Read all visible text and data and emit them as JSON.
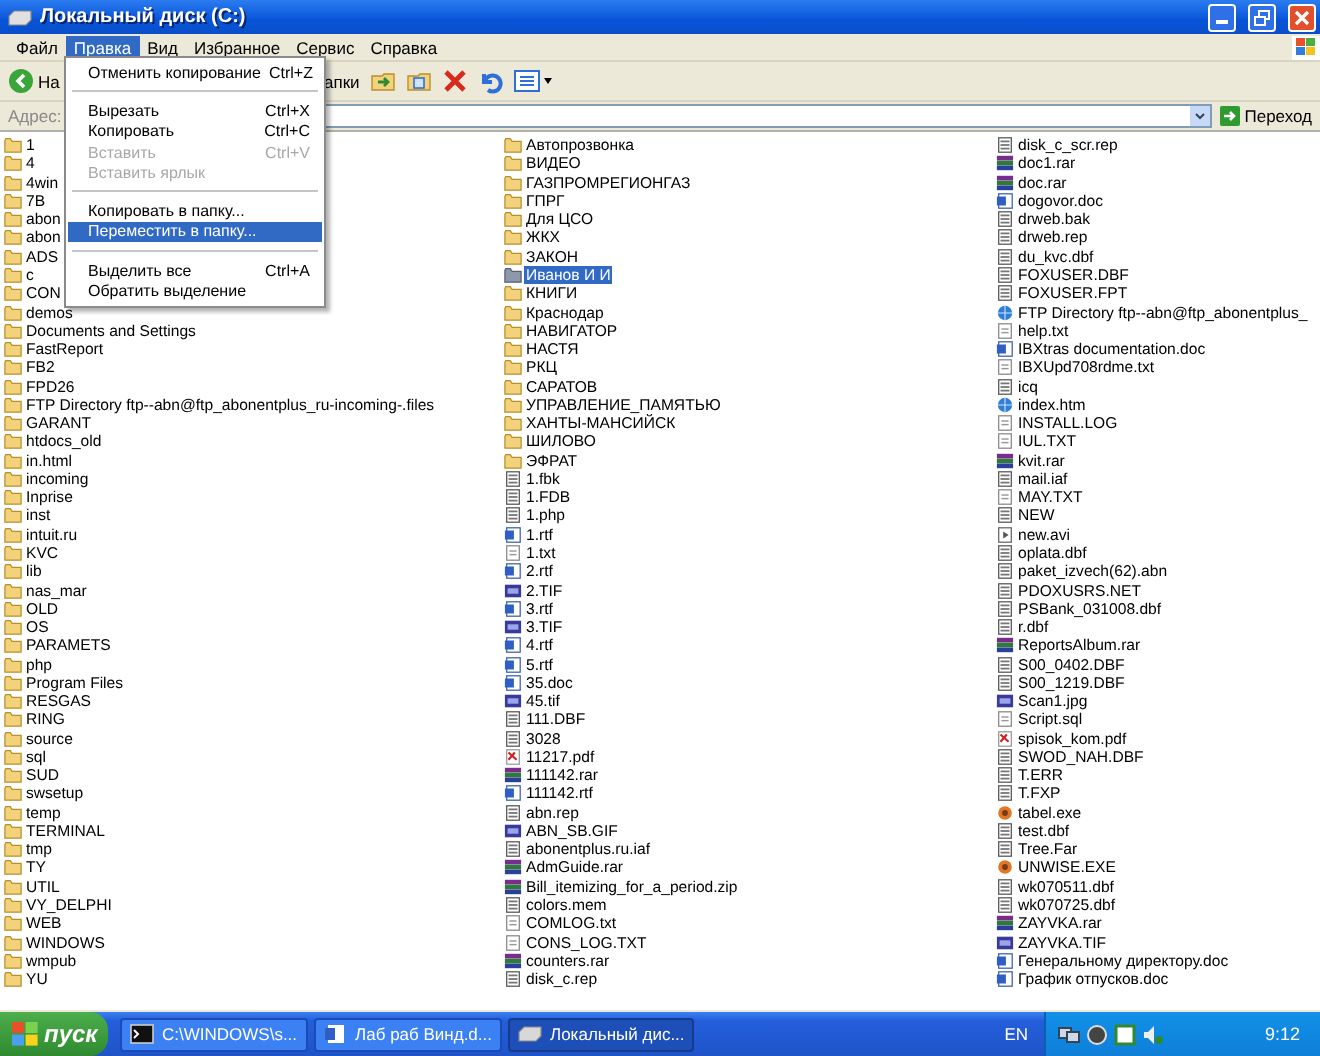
{
  "window": {
    "title": "Локальный диск (C:)"
  },
  "menu_bar": [
    {
      "label": "Файл",
      "selected": false
    },
    {
      "label": "Правка",
      "selected": true
    },
    {
      "label": "Вид",
      "selected": false
    },
    {
      "label": "Избранное",
      "selected": false
    },
    {
      "label": "Сервис",
      "selected": false
    },
    {
      "label": "Справка",
      "selected": false
    }
  ],
  "edit_menu": [
    {
      "kind": "command",
      "label": "Отменить копирование",
      "shortcut": "Ctrl+Z",
      "disabled": false,
      "selected": false
    },
    {
      "kind": "separator"
    },
    {
      "kind": "command",
      "label": "Вырезать",
      "shortcut": "Ctrl+X",
      "disabled": false,
      "selected": false
    },
    {
      "kind": "command",
      "label": "Копировать",
      "shortcut": "Ctrl+C",
      "disabled": false,
      "selected": false
    },
    {
      "kind": "command",
      "label": "Вставить",
      "shortcut": "Ctrl+V",
      "disabled": true,
      "selected": false
    },
    {
      "kind": "command",
      "label": "Вставить ярлык",
      "disabled": true,
      "selected": false
    },
    {
      "kind": "separator"
    },
    {
      "kind": "command",
      "label": "Копировать в папку...",
      "disabled": false,
      "selected": false
    },
    {
      "kind": "command",
      "label": "Переместить в папку...",
      "disabled": false,
      "selected": true
    },
    {
      "kind": "separator"
    },
    {
      "kind": "command",
      "label": "Выделить все",
      "shortcut": "Ctrl+A",
      "disabled": false,
      "selected": false
    },
    {
      "kind": "command",
      "label": "Обратить выделение",
      "disabled": false,
      "selected": false
    }
  ],
  "toolbar": {
    "back_button": "На",
    "folders_button": "апки"
  },
  "address_bar": {
    "label": "Адрес:",
    "go_button": "Переход"
  },
  "file_list": {
    "columns": [
      [
        {
          "name": "1",
          "kind": "folder",
          "selected": false
        },
        {
          "name": "4",
          "kind": "folder",
          "selected": false
        },
        {
          "name": "4win",
          "kind": "folder",
          "selected": false
        },
        {
          "name": "7B",
          "kind": "folder",
          "selected": false
        },
        {
          "name": "abon",
          "kind": "folder",
          "selected": false
        },
        {
          "name": "abon",
          "kind": "folder",
          "selected": false
        },
        {
          "name": "ADS",
          "kind": "folder",
          "selected": false
        },
        {
          "name": "c",
          "kind": "folder",
          "selected": false
        },
        {
          "name": "CON",
          "kind": "folder",
          "selected": false
        },
        {
          "name": "demos",
          "kind": "folder",
          "selected": false
        },
        {
          "name": "Documents and Settings",
          "kind": "folder",
          "selected": false
        },
        {
          "name": "FastReport",
          "kind": "folder",
          "selected": false
        },
        {
          "name": "FB2",
          "kind": "folder",
          "selected": false
        },
        {
          "name": "FPD26",
          "kind": "folder",
          "selected": false
        },
        {
          "name": "FTP Directory ftp--abn@ftp_abonentplus_ru-incoming-.files",
          "kind": "folder",
          "selected": false
        },
        {
          "name": "GARANT",
          "kind": "folder",
          "selected": false
        },
        {
          "name": "htdocs_old",
          "kind": "folder",
          "selected": false
        },
        {
          "name": "in.html",
          "kind": "folder",
          "selected": false
        },
        {
          "name": "incoming",
          "kind": "folder",
          "selected": false
        },
        {
          "name": "Inprise",
          "kind": "folder",
          "selected": false
        },
        {
          "name": "inst",
          "kind": "folder",
          "selected": false
        },
        {
          "name": "intuit.ru",
          "kind": "folder",
          "selected": false
        },
        {
          "name": "KVC",
          "kind": "folder",
          "selected": false
        },
        {
          "name": "lib",
          "kind": "folder",
          "selected": false
        },
        {
          "name": "nas_mar",
          "kind": "folder",
          "selected": false
        },
        {
          "name": "OLD",
          "kind": "folder",
          "selected": false
        },
        {
          "name": "OS",
          "kind": "folder",
          "selected": false
        },
        {
          "name": "PARAMETS",
          "kind": "folder",
          "selected": false
        },
        {
          "name": "php",
          "kind": "folder",
          "selected": false
        },
        {
          "name": "Program Files",
          "kind": "folder",
          "selected": false
        },
        {
          "name": "RESGAS",
          "kind": "folder",
          "selected": false
        },
        {
          "name": "RING",
          "kind": "folder",
          "selected": false
        },
        {
          "name": "source",
          "kind": "folder",
          "selected": false
        },
        {
          "name": "sql",
          "kind": "folder",
          "selected": false
        },
        {
          "name": "SUD",
          "kind": "folder",
          "selected": false
        },
        {
          "name": "swsetup",
          "kind": "folder",
          "selected": false
        },
        {
          "name": "temp",
          "kind": "folder",
          "selected": false
        },
        {
          "name": "TERMINAL",
          "kind": "folder",
          "selected": false
        },
        {
          "name": "tmp",
          "kind": "folder",
          "selected": false
        },
        {
          "name": "TY",
          "kind": "folder",
          "selected": false
        },
        {
          "name": "UTIL",
          "kind": "folder",
          "selected": false
        },
        {
          "name": "VY_DELPHI",
          "kind": "folder",
          "selected": false
        },
        {
          "name": "WEB",
          "kind": "folder",
          "selected": false
        },
        {
          "name": "WINDOWS",
          "kind": "folder",
          "selected": false
        },
        {
          "name": "wmpub",
          "kind": "folder",
          "selected": false
        },
        {
          "name": "YU",
          "kind": "folder",
          "selected": false
        }
      ],
      [
        {
          "name": "Автопрозвонка",
          "kind": "folder",
          "selected": false
        },
        {
          "name": "ВИДЕО",
          "kind": "folder",
          "selected": false
        },
        {
          "name": "ГАЗПРОМРЕГИОНГАЗ",
          "kind": "folder",
          "selected": false
        },
        {
          "name": "ГПРГ",
          "kind": "folder",
          "selected": false
        },
        {
          "name": "Для ЦСО",
          "kind": "folder",
          "selected": false
        },
        {
          "name": "ЖКХ",
          "kind": "folder",
          "selected": false
        },
        {
          "name": "ЗАКОН",
          "kind": "folder",
          "selected": false
        },
        {
          "name": "Иванов И И",
          "kind": "folder",
          "selected": true
        },
        {
          "name": "КНИГИ",
          "kind": "folder",
          "selected": false
        },
        {
          "name": "Краснодар",
          "kind": "folder",
          "selected": false
        },
        {
          "name": "НАВИГАТОР",
          "kind": "folder",
          "selected": false
        },
        {
          "name": "НАСТЯ",
          "kind": "folder",
          "selected": false
        },
        {
          "name": "РКЦ",
          "kind": "folder",
          "selected": false
        },
        {
          "name": "САРАТОВ",
          "kind": "folder",
          "selected": false
        },
        {
          "name": "УПРАВЛЕНИЕ_ПАМЯТЬЮ",
          "kind": "folder",
          "selected": false
        },
        {
          "name": "ХАНТЫ-МАНСИЙСК",
          "kind": "folder",
          "selected": false
        },
        {
          "name": "ШИЛОВО",
          "kind": "folder",
          "selected": false
        },
        {
          "name": "ЭФРАТ",
          "kind": "folder",
          "selected": false
        },
        {
          "name": "1.fbk",
          "kind": "file",
          "selected": false
        },
        {
          "name": "1.FDB",
          "kind": "file",
          "selected": false
        },
        {
          "name": "1.php",
          "kind": "file",
          "selected": false
        },
        {
          "name": "1.rtf",
          "kind": "document",
          "selected": false
        },
        {
          "name": "1.txt",
          "kind": "text",
          "selected": false
        },
        {
          "name": "2.rtf",
          "kind": "document",
          "selected": false
        },
        {
          "name": "2.TIF",
          "kind": "image",
          "selected": false
        },
        {
          "name": "3.rtf",
          "kind": "document",
          "selected": false
        },
        {
          "name": "3.TIF",
          "kind": "image",
          "selected": false
        },
        {
          "name": "4.rtf",
          "kind": "document",
          "selected": false
        },
        {
          "name": "5.rtf",
          "kind": "document",
          "selected": false
        },
        {
          "name": "35.doc",
          "kind": "document",
          "selected": false
        },
        {
          "name": "45.tif",
          "kind": "image",
          "selected": false
        },
        {
          "name": "111.DBF",
          "kind": "file",
          "selected": false
        },
        {
          "name": "3028",
          "kind": "file",
          "selected": false
        },
        {
          "name": "11217.pdf",
          "kind": "pdf",
          "selected": false
        },
        {
          "name": "111142.rar",
          "kind": "archive",
          "selected": false
        },
        {
          "name": "111142.rtf",
          "kind": "document",
          "selected": false
        },
        {
          "name": "abn.rep",
          "kind": "file",
          "selected": false
        },
        {
          "name": "ABN_SB.GIF",
          "kind": "image",
          "selected": false
        },
        {
          "name": "abonentplus.ru.iaf",
          "kind": "file",
          "selected": false
        },
        {
          "name": "AdmGuide.rar",
          "kind": "archive",
          "selected": false
        },
        {
          "name": "Bill_itemizing_for_a_period.zip",
          "kind": "archive",
          "selected": false
        },
        {
          "name": "colors.mem",
          "kind": "file",
          "selected": false
        },
        {
          "name": "COMLOG.txt",
          "kind": "text",
          "selected": false
        },
        {
          "name": "CONS_LOG.TXT",
          "kind": "text",
          "selected": false
        },
        {
          "name": "counters.rar",
          "kind": "archive",
          "selected": false
        },
        {
          "name": "disk_c.rep",
          "kind": "file",
          "selected": false
        }
      ],
      [
        {
          "name": "disk_c_scr.rep",
          "kind": "file",
          "selected": false
        },
        {
          "name": "doc1.rar",
          "kind": "archive",
          "selected": false
        },
        {
          "name": "doc.rar",
          "kind": "archive",
          "selected": false
        },
        {
          "name": "dogovor.doc",
          "kind": "document",
          "selected": false
        },
        {
          "name": "drweb.bak",
          "kind": "file",
          "selected": false
        },
        {
          "name": "drweb.rep",
          "kind": "file",
          "selected": false
        },
        {
          "name": "du_kvc.dbf",
          "kind": "file",
          "selected": false
        },
        {
          "name": "FOXUSER.DBF",
          "kind": "file",
          "selected": false
        },
        {
          "name": "FOXUSER.FPT",
          "kind": "file",
          "selected": false
        },
        {
          "name": "FTP Directory ftp--abn@ftp_abonentplus_",
          "kind": "web",
          "selected": false
        },
        {
          "name": "help.txt",
          "kind": "text",
          "selected": false
        },
        {
          "name": "IBXtras documentation.doc",
          "kind": "document",
          "selected": false
        },
        {
          "name": "IBXUpd708rdme.txt",
          "kind": "text",
          "selected": false
        },
        {
          "name": "icq",
          "kind": "file",
          "selected": false
        },
        {
          "name": "index.htm",
          "kind": "web",
          "selected": false
        },
        {
          "name": "INSTALL.LOG",
          "kind": "text",
          "selected": false
        },
        {
          "name": "IUL.TXT",
          "kind": "text",
          "selected": false
        },
        {
          "name": "kvit.rar",
          "kind": "archive",
          "selected": false
        },
        {
          "name": "mail.iaf",
          "kind": "file",
          "selected": false
        },
        {
          "name": "MAY.TXT",
          "kind": "text",
          "selected": false
        },
        {
          "name": "NEW",
          "kind": "file",
          "selected": false
        },
        {
          "name": "new.avi",
          "kind": "video",
          "selected": false
        },
        {
          "name": "oplata.dbf",
          "kind": "file",
          "selected": false
        },
        {
          "name": "paket_izvech(62).abn",
          "kind": "file",
          "selected": false
        },
        {
          "name": "PDOXUSRS.NET",
          "kind": "file",
          "selected": false
        },
        {
          "name": "PSBank_031008.dbf",
          "kind": "file",
          "selected": false
        },
        {
          "name": "r.dbf",
          "kind": "file",
          "selected": false
        },
        {
          "name": "ReportsAlbum.rar",
          "kind": "archive",
          "selected": false
        },
        {
          "name": "S00_0402.DBF",
          "kind": "file",
          "selected": false
        },
        {
          "name": "S00_1219.DBF",
          "kind": "file",
          "selected": false
        },
        {
          "name": "Scan1.jpg",
          "kind": "image",
          "selected": false
        },
        {
          "name": "Script.sql",
          "kind": "text",
          "selected": false
        },
        {
          "name": "spisok_kom.pdf",
          "kind": "pdf",
          "selected": false
        },
        {
          "name": "SWOD_NAH.DBF",
          "kind": "file",
          "selected": false
        },
        {
          "name": "T.ERR",
          "kind": "file",
          "selected": false
        },
        {
          "name": "T.FXP",
          "kind": "file",
          "selected": false
        },
        {
          "name": "tabel.exe",
          "kind": "program",
          "selected": false
        },
        {
          "name": "test.dbf",
          "kind": "file",
          "selected": false
        },
        {
          "name": "Tree.Far",
          "kind": "file",
          "selected": false
        },
        {
          "name": "UNWISE.EXE",
          "kind": "program",
          "selected": false
        },
        {
          "name": "wk070511.dbf",
          "kind": "file",
          "selected": false
        },
        {
          "name": "wk070725.dbf",
          "kind": "file",
          "selected": false
        },
        {
          "name": "ZAYVKA.rar",
          "kind": "archive",
          "selected": false
        },
        {
          "name": "ZAYVKA.TIF",
          "kind": "image",
          "selected": false
        },
        {
          "name": "Генеральному директору.doc",
          "kind": "document",
          "selected": false
        },
        {
          "name": "График отпусков.doc",
          "kind": "document",
          "selected": false
        }
      ]
    ]
  },
  "taskbar": {
    "start_button": "пуск",
    "tasks": [
      {
        "label": "C:\\WINDOWS\\s...",
        "kind": "console",
        "selected": false
      },
      {
        "label": "Лаб раб Винд.d...",
        "kind": "document",
        "selected": false
      },
      {
        "label": "Локальный дис...",
        "kind": "drive",
        "selected": true
      }
    ],
    "language": "EN",
    "clock": "9:12"
  }
}
